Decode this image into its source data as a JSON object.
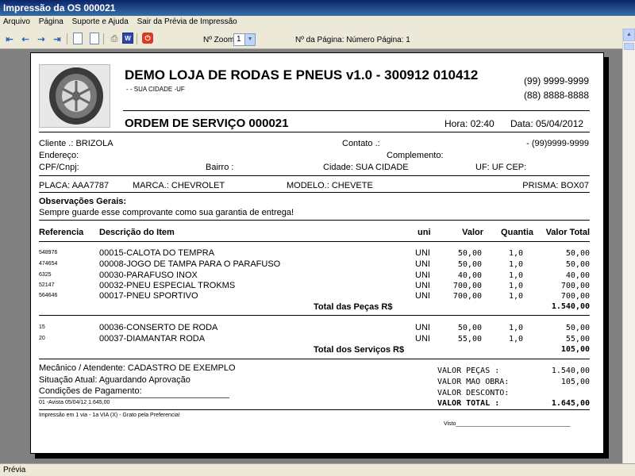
{
  "window": {
    "title": "Impressão da OS 000021"
  },
  "menu": [
    "Arquivo",
    "Página",
    "Suporte e Ajuda",
    "Sair da Prévia de Impressão"
  ],
  "toolbar": {
    "zoom_label": "Nº Zoom",
    "zoom_value": "1",
    "page_label": "Nº da Página: Número Página: 1",
    "icons": [
      "first-page-icon",
      "previous-page-icon",
      "next-page-icon",
      "last-page-icon",
      "single-page-icon",
      "multi-page-icon",
      "print-icon",
      "word-export-icon",
      "close-preview-icon"
    ]
  },
  "status": {
    "text": "Prévia"
  },
  "report": {
    "company": "DEMO LOJA DE RODAS E PNEUS v1.0 - 300912 010412",
    "company_sub": "-  - SUA CIDADE -UF",
    "phone1": "(99) 9999-9999",
    "phone2": "(88) 8888-8888",
    "os_title": "ORDEM DE SERVIÇO 000021",
    "hora": "Hora: 02:40",
    "data": "Data: 05/04/2012",
    "cliente": "Cliente    .: BRIZOLA",
    "contato": "Contato .:",
    "cliente_fone": "- (99)9999-9999",
    "endereco": "Endereço:",
    "complemento": "Complemento:",
    "cpf": "CPF/Cnpj:",
    "bairro": "Bairro :",
    "cidade": "Cidade: SUA CIDADE",
    "uf_cep": "UF: UF  CEP:",
    "placa": "PLACA: AAA7787",
    "marca": "MARCA.: CHEVROLET",
    "modelo": "MODELO.: CHEVETE",
    "prisma": "PRISMA: BOX07",
    "obs_title": "Observações Gerais:",
    "obs_text": "Sempre guarde esse comprovante como sua garantia de entrega!",
    "columns": {
      "ref": "Referencia",
      "desc": "Descrição do Item",
      "uni": "uni",
      "valor": "Valor",
      "qtd": "Quantia",
      "total": "Valor Total"
    },
    "pecas": [
      {
        "ref": "548976",
        "desc": "00015-CALOTA DO TEMPRA",
        "uni": "UNI",
        "valor": "50,00",
        "qtd": "1,0",
        "total": "50,00"
      },
      {
        "ref": "474654",
        "desc": "00008-JOGO DE TAMPA PARA O PARAFUSO",
        "uni": "UNI",
        "valor": "50,00",
        "qtd": "1,0",
        "total": "50,00"
      },
      {
        "ref": "6325",
        "desc": "00030-PARAFUSO INOX",
        "uni": "UNI",
        "valor": "40,00",
        "qtd": "1,0",
        "total": "40,00"
      },
      {
        "ref": "52147",
        "desc": "00032-PNEU ESPECIAL TROKMS",
        "uni": "UNI",
        "valor": "700,00",
        "qtd": "1,0",
        "total": "700,00"
      },
      {
        "ref": "564646",
        "desc": "00017-PNEU SPORTIVO",
        "uni": "UNI",
        "valor": "700,00",
        "qtd": "1,0",
        "total": "700,00"
      }
    ],
    "total_pecas_label": "Total das Peças R$",
    "total_pecas": "1.540,00",
    "servicos": [
      {
        "ref": "15",
        "desc": "00036-CONSERTO DE RODA",
        "uni": "UNI",
        "valor": "50,00",
        "qtd": "1,0",
        "total": "50,00"
      },
      {
        "ref": "20",
        "desc": "00037-DIAMANTAR RODA",
        "uni": "UNI",
        "valor": "55,00",
        "qtd": "1,0",
        "total": "55,00"
      }
    ],
    "total_servicos_label": "Total dos Serviços R$",
    "total_servicos": "105,00",
    "mecanico": "Mecânico / Atendente: CADASTRO DE EXEMPLO",
    "situacao": "Situação Atual: Aguardando Aprovação",
    "condicoes": "Condições de Pagamento:",
    "pagamento_linha": "01 -Avista          05/04/12  1.645,00",
    "resumo": [
      {
        "label": "VALOR PEÇAS    :",
        "value": "1.540,00"
      },
      {
        "label": "VALOR MAO OBRA:",
        "value": "105,00"
      },
      {
        "label": "VALOR DESCONTO:",
        "value": ""
      },
      {
        "label": "VALOR TOTAL    :",
        "value": "1.645,00"
      }
    ],
    "footer": "Impressão em 1 via  -  1a VIA (X) - Grato pela Preferencia!",
    "visto": "Visto_____________________________________"
  }
}
